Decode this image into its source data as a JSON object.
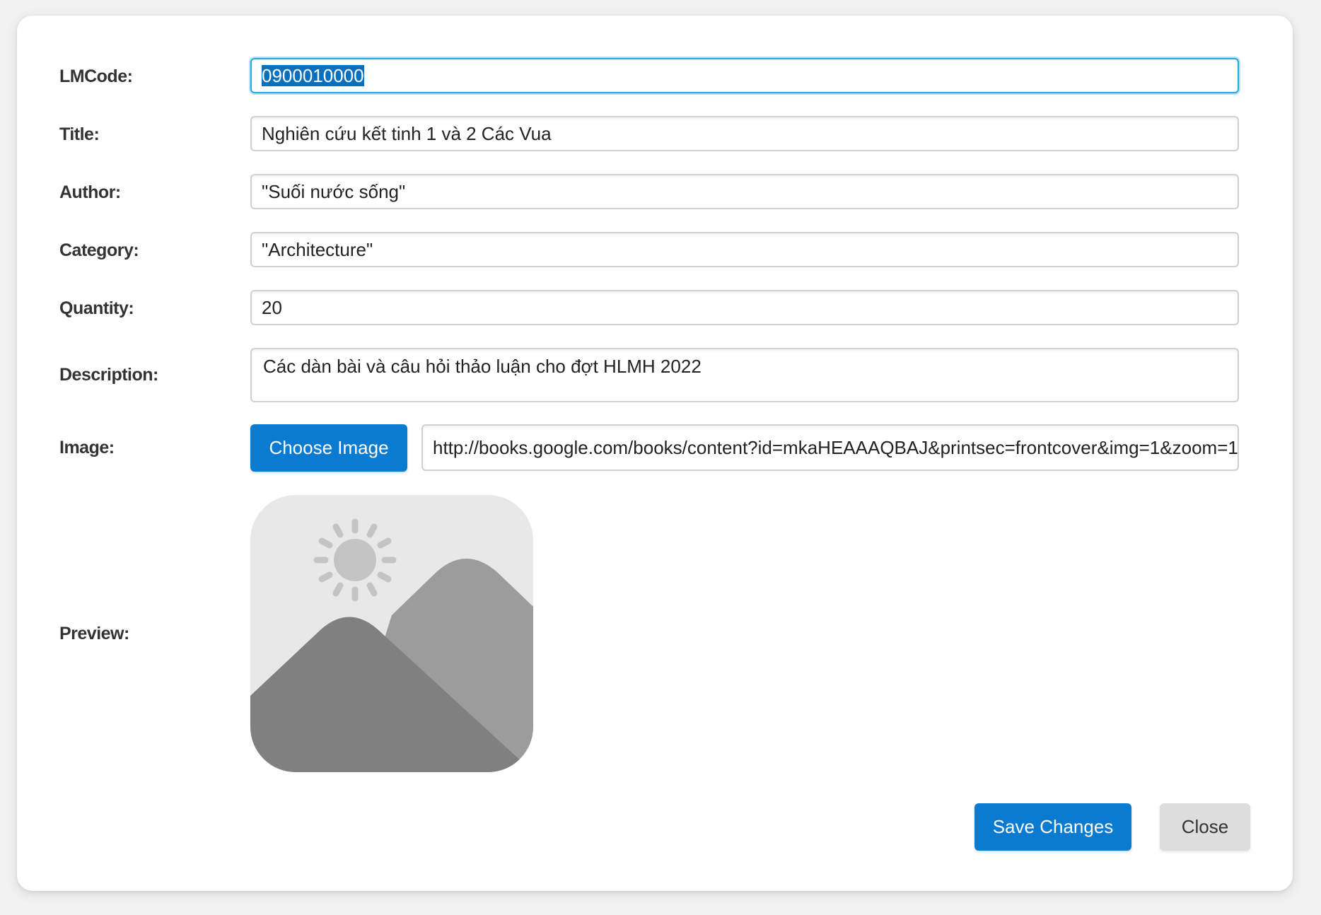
{
  "form": {
    "lmcode": {
      "label": "LMCode:",
      "value": "0900010000"
    },
    "title": {
      "label": "Title:",
      "value": "Nghiên cứu kết tinh 1 và 2 Các Vua"
    },
    "author": {
      "label": "Author:",
      "value": "\"Suối nước sống\""
    },
    "category": {
      "label": "Category:",
      "value": "\"Architecture\""
    },
    "quantity": {
      "label": "Quantity:",
      "value": "20"
    },
    "description": {
      "label": "Description:",
      "value": "Các dàn bài và câu hỏi thảo luận cho đợt HLMH 2022"
    },
    "image": {
      "label": "Image:",
      "choose_label": "Choose Image",
      "url": "http://books.google.com/books/content?id=mkaHEAAAQBAJ&printsec=frontcover&img=1&zoom=1&edge=curl&source=gbs_api"
    },
    "preview": {
      "label": "Preview:",
      "icon": "image-placeholder-icon"
    }
  },
  "actions": {
    "save_label": "Save Changes",
    "close_label": "Close"
  },
  "colors": {
    "primary": "#0a7bd1",
    "focus": "#29a8e0",
    "secondary": "#dddddd"
  }
}
